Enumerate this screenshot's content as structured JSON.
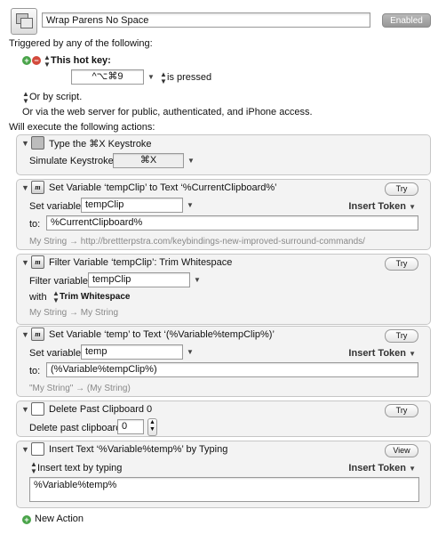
{
  "macro": {
    "name": "Wrap Parens No Space",
    "enabled_label": "Enabled"
  },
  "triggers": {
    "heading": "Triggered by any of the following:",
    "hotkey_label": "This hot key:",
    "hotkey_value": "^⌥⌘9",
    "pressed_label": "is pressed",
    "or_by_script": "Or by script.",
    "web_server": "Or via the web server for public, authenticated, and iPhone access."
  },
  "actions_heading": "Will execute the following actions:",
  "actions": [
    {
      "title": "Type the ⌘X Keystroke",
      "label": "Simulate Keystroke:",
      "value": "⌘X"
    },
    {
      "title": "Set Variable ‘tempClip’ to Text ‘%CurrentClipboard%’",
      "button": "Try",
      "set_label": "Set variable",
      "var_name": "tempClip",
      "insert_token": "Insert Token",
      "to_label": "to:",
      "to_value": "%CurrentClipboard%",
      "preview": "My String → http://brettterpstra.com/keybindings-new-improved-surround-commands/"
    },
    {
      "title": "Filter Variable ‘tempClip’: Trim Whitespace",
      "button": "Try",
      "filter_label": "Filter variable",
      "var_name": "tempClip",
      "with_label": "with",
      "with_value": "Trim Whitespace",
      "preview": "My String → My String"
    },
    {
      "title": "Set Variable ‘temp’ to Text ‘(%Variable%tempClip%)’",
      "button": "Try",
      "set_label": "Set variable",
      "var_name": "temp",
      "insert_token": "Insert Token",
      "to_label": "to:",
      "to_value": "(%Variable%tempClip%)",
      "preview": "\"My String\" → (My String)"
    },
    {
      "title": "Delete Past Clipboard 0",
      "button": "Try",
      "label": "Delete past clipboard",
      "value": "0"
    },
    {
      "title": "Insert Text ‘%Variable%temp%’ by Typing",
      "button": "View",
      "mode": "Insert text by typing",
      "insert_token": "Insert Token",
      "text": "%Variable%temp%"
    }
  ],
  "new_action": "New Action",
  "colors": {
    "add": "#4aa44a",
    "remove": "#d34a3c",
    "enabled_button": "#a8a8a8",
    "action_bg": "#f3f3f3"
  },
  "icons": {
    "macro": "stacked-windows-icon",
    "keystroke": "keyboard-icon",
    "variable": "m-script-icon",
    "clipboard": "document-icon"
  }
}
